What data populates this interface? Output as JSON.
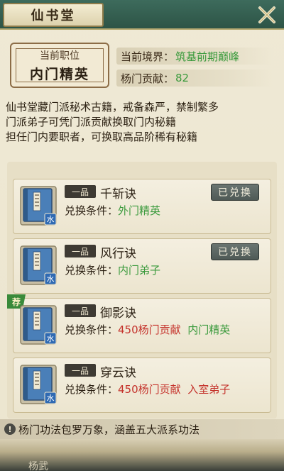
{
  "header": {
    "title": "仙书堂"
  },
  "rank": {
    "label": "当前职位",
    "value": "内门精英"
  },
  "realm": {
    "label": "当前境界：",
    "value": "筑基前期巅峰"
  },
  "contribution": {
    "label": "杨门贡献：",
    "value": "82"
  },
  "description": [
    "仙书堂藏门派秘术古籍，戒备森严，禁制繁多",
    "门派弟子可凭门派贡献换取门内秘籍",
    "担任门内要职者，可换取高品阶稀有秘籍"
  ],
  "books": [
    {
      "grade": "一品",
      "name": "千斩诀",
      "cond_label": "兑换条件：",
      "cost": "",
      "requirement": "外门精英",
      "status": "已兑换",
      "recommended": false,
      "element": "水",
      "color": "#4a7fb8"
    },
    {
      "grade": "一品",
      "name": "风行诀",
      "cond_label": "兑换条件：",
      "cost": "",
      "requirement": "内门弟子",
      "status": "已兑换",
      "recommended": false,
      "element": "水",
      "color": "#4a7fb8"
    },
    {
      "grade": "一品",
      "name": "御影诀",
      "cond_label": "兑换条件：",
      "cost": "450杨门贡献",
      "requirement": "内门精英",
      "status": "",
      "recommended": true,
      "recommend_label": "荐",
      "element": "水",
      "color": "#4a7fb8"
    },
    {
      "grade": "一品",
      "name": "穿云诀",
      "cond_label": "兑换条件：",
      "cost": "450杨门贡献",
      "requirement": "入室弟子",
      "status": "",
      "recommended": false,
      "element": "水",
      "color": "#4a7fb8"
    }
  ],
  "tip": {
    "icon": "!",
    "text": "杨门功法包罗万象，涵盖五大派系功法"
  },
  "bottom": {
    "partial_text": "杨武"
  }
}
